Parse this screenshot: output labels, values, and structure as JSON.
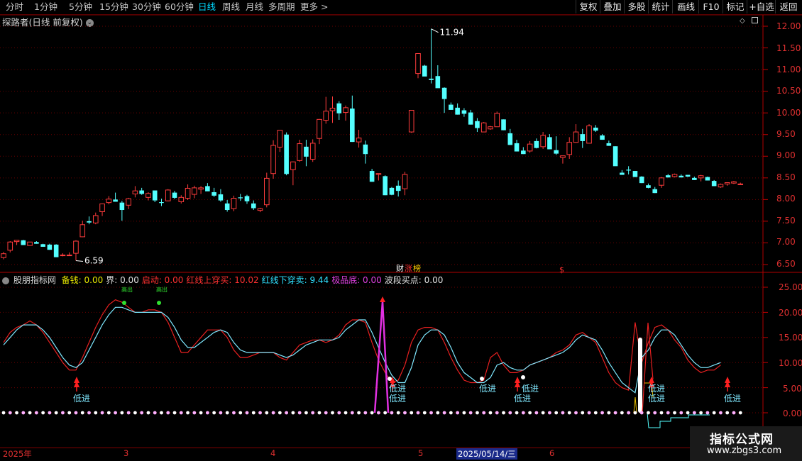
{
  "toolbar": {
    "periods": [
      "分时",
      "1分钟",
      "5分钟",
      "15分钟",
      "30分钟",
      "60分钟",
      "日线",
      "周线",
      "月线",
      "多周期",
      "更多 >"
    ],
    "active_period": "日线",
    "right_buttons": [
      "复权",
      "叠加",
      "多股",
      "统计",
      "画线",
      "F10",
      "标记",
      "+自选",
      "返回"
    ]
  },
  "price_panel": {
    "title": "探路者(日线 前复权)",
    "axis_ticks": [
      "12.00",
      "11.50",
      "11.00",
      "10.50",
      "10.00",
      "9.50",
      "9.00",
      "8.50",
      "8.00",
      "7.50",
      "7.00",
      "6.50"
    ],
    "high_label": "11.94",
    "low_label": "6.59",
    "event_markers": [
      "财",
      "涨",
      "榜",
      "$"
    ]
  },
  "indicator_panel": {
    "name": "股朋指标网",
    "fields": [
      {
        "label": "备钱:",
        "value": "0.00",
        "color": "#e8e800"
      },
      {
        "label": "界:",
        "value": "0.00",
        "color": "#e0e0e0"
      },
      {
        "label": "启动:",
        "value": "0.00",
        "color": "#ff3030"
      },
      {
        "label": "红线上穿买:",
        "value": "10.02",
        "color": "#ff3030"
      },
      {
        "label": "红线下穿卖:",
        "value": "9.44",
        "color": "#30e0ff"
      },
      {
        "label": "极品底:",
        "value": "0.00",
        "color": "#e040e0"
      },
      {
        "label": "波段买点:",
        "value": "0.00",
        "color": "#e0e0e0"
      }
    ],
    "axis_ticks": [
      "25.00",
      "20.00",
      "15.00",
      "10.00",
      "5.00",
      "0.00"
    ],
    "signal_text": "低进",
    "top_marker_text": "高出"
  },
  "datebar": {
    "labels": [
      "2025年",
      "3",
      "4",
      "5",
      "2025/05/14/三",
      "6"
    ]
  },
  "watermark": {
    "line1": "指标公式网",
    "line2": "www.zbgs3.com"
  },
  "chart_data": {
    "type": "candlestick",
    "series": [
      {
        "name": "candles",
        "ohlc": [
          [
            6.66,
            6.79,
            6.62,
            6.75
          ],
          [
            6.83,
            7.04,
            6.78,
            7.02
          ],
          [
            7.03,
            7.06,
            6.95,
            7.06
          ],
          [
            7.06,
            7.07,
            6.95,
            6.95
          ],
          [
            6.94,
            7.02,
            6.94,
            7.02
          ],
          [
            7.02,
            7.04,
            6.98,
            6.98
          ],
          [
            6.97,
            6.98,
            6.91,
            6.91
          ],
          [
            6.96,
            6.98,
            6.84,
            6.84
          ],
          [
            6.96,
            6.97,
            6.67,
            6.67
          ],
          [
            6.71,
            6.76,
            6.69,
            6.72
          ],
          [
            6.71,
            6.78,
            6.7,
            6.72
          ],
          [
            6.76,
            7.06,
            6.59,
            7.04
          ],
          [
            7.14,
            7.51,
            7.13,
            7.42
          ],
          [
            7.5,
            7.61,
            7.43,
            7.47
          ],
          [
            7.46,
            7.7,
            7.43,
            7.63
          ],
          [
            7.72,
            7.91,
            7.62,
            7.9
          ],
          [
            7.93,
            8.08,
            7.89,
            8.01
          ],
          [
            8.0,
            8.16,
            7.98,
            7.95
          ],
          [
            7.93,
            7.97,
            7.51,
            7.76
          ],
          [
            7.87,
            8.04,
            7.78,
            8.02
          ],
          [
            8.13,
            8.31,
            8.05,
            8.2
          ],
          [
            8.21,
            8.27,
            8.11,
            8.13
          ],
          [
            8.05,
            8.17,
            7.98,
            8.14
          ],
          [
            8.21,
            8.21,
            7.94,
            7.98
          ],
          [
            7.94,
            8.02,
            7.85,
            7.92
          ],
          [
            7.97,
            8.24,
            7.96,
            8.22
          ],
          [
            8.16,
            8.2,
            8.01,
            8.04
          ],
          [
            7.95,
            8.1,
            7.91,
            8.05
          ],
          [
            8.03,
            8.35,
            7.99,
            8.26
          ],
          [
            8.12,
            8.32,
            8.03,
            8.27
          ],
          [
            8.24,
            8.31,
            8.13,
            8.27
          ],
          [
            8.31,
            8.38,
            8.22,
            8.19
          ],
          [
            8.17,
            8.27,
            8.06,
            8.09
          ],
          [
            8.12,
            8.24,
            7.95,
            7.98
          ],
          [
            7.91,
            7.99,
            7.72,
            7.76
          ],
          [
            7.79,
            8.09,
            7.73,
            8.03
          ],
          [
            8.05,
            8.13,
            7.97,
            8.03
          ],
          [
            8.08,
            8.11,
            7.9,
            7.96
          ],
          [
            7.91,
            7.98,
            7.76,
            7.8
          ],
          [
            7.75,
            7.81,
            7.71,
            7.79
          ],
          [
            7.88,
            8.62,
            7.82,
            8.49
          ],
          [
            8.6,
            9.37,
            8.48,
            9.25
          ],
          [
            9.21,
            9.53,
            9.1,
            9.6
          ],
          [
            9.5,
            9.55,
            8.56,
            8.59
          ],
          [
            8.69,
            8.88,
            8.33,
            8.87
          ],
          [
            8.9,
            9.38,
            8.87,
            9.29
          ],
          [
            9.22,
            9.38,
            8.77,
            8.99
          ],
          [
            8.93,
            9.39,
            8.87,
            9.3
          ],
          [
            9.41,
            9.86,
            9.28,
            9.85
          ],
          [
            9.83,
            10.37,
            9.75,
            10.04
          ],
          [
            10.05,
            10.38,
            9.77,
            10.11
          ],
          [
            10.22,
            10.27,
            9.84,
            9.99
          ],
          [
            10.01,
            10.17,
            9.82,
            10.12
          ],
          [
            10.1,
            10.4,
            9.33,
            9.33
          ],
          [
            9.33,
            9.61,
            9.2,
            9.42
          ],
          [
            9.27,
            9.36,
            8.83,
            9.05
          ],
          [
            8.66,
            8.71,
            8.41,
            8.41
          ],
          [
            8.58,
            8.6,
            8.44,
            8.6
          ],
          [
            8.54,
            8.56,
            8.1,
            8.1
          ],
          [
            8.27,
            8.29,
            8.1,
            8.11
          ],
          [
            8.32,
            8.44,
            8.07,
            8.2
          ],
          [
            8.25,
            8.64,
            8.1,
            8.58
          ],
          [
            9.56,
            10.03,
            9.54,
            10.06
          ],
          [
            10.91,
            10.94,
            10.8,
            11.37
          ],
          [
            11.09,
            11.11,
            10.89,
            10.84
          ],
          [
            10.79,
            11.94,
            10.68,
            10.76
          ],
          [
            10.85,
            11.1,
            10.71,
            10.57
          ],
          [
            10.58,
            10.59,
            10.0,
            10.32
          ],
          [
            10.19,
            10.24,
            10.07,
            10.07
          ],
          [
            10.12,
            10.22,
            9.96,
            9.96
          ],
          [
            10.06,
            10.11,
            9.91,
            9.98
          ],
          [
            10.01,
            10.07,
            9.73,
            9.73
          ],
          [
            9.81,
            9.88,
            9.56,
            9.65
          ],
          [
            9.56,
            9.79,
            9.59,
            9.77
          ],
          [
            9.63,
            9.7,
            9.61,
            9.68
          ],
          [
            9.68,
            10.03,
            9.68,
            9.99
          ],
          [
            9.85,
            9.85,
            9.6,
            9.6
          ],
          [
            9.53,
            9.63,
            9.26,
            9.26
          ],
          [
            9.3,
            9.38,
            9.11,
            9.11
          ],
          [
            9.13,
            9.21,
            9.05,
            9.05
          ],
          [
            9.12,
            9.35,
            9.08,
            9.28
          ],
          [
            9.35,
            9.41,
            9.18,
            9.19
          ],
          [
            9.22,
            9.56,
            9.17,
            9.48
          ],
          [
            9.44,
            9.51,
            9.23,
            9.16
          ],
          [
            9.14,
            9.46,
            9.03,
            9.06
          ],
          [
            8.97,
            9.01,
            8.83,
            9.01
          ],
          [
            9.04,
            9.44,
            8.94,
            9.32
          ],
          [
            9.32,
            9.74,
            9.31,
            9.56
          ],
          [
            9.51,
            9.63,
            9.19,
            9.35
          ],
          [
            9.3,
            9.74,
            9.3,
            9.7
          ],
          [
            9.66,
            9.72,
            9.56,
            9.59
          ],
          [
            9.48,
            9.51,
            9.38,
            9.38
          ],
          [
            9.3,
            9.36,
            9.24,
            9.24
          ],
          [
            9.23,
            9.23,
            8.78,
            8.77
          ],
          [
            8.62,
            8.68,
            8.57,
            8.57
          ],
          [
            8.69,
            8.77,
            8.58,
            8.67
          ],
          [
            8.66,
            8.66,
            8.52,
            8.52
          ],
          [
            8.53,
            8.54,
            8.38,
            8.38
          ],
          [
            8.33,
            8.37,
            8.26,
            8.27
          ],
          [
            8.24,
            8.29,
            8.15,
            8.15
          ],
          [
            8.33,
            8.52,
            8.27,
            8.5
          ],
          [
            8.56,
            8.59,
            8.51,
            8.51
          ],
          [
            8.53,
            8.6,
            8.51,
            8.58
          ],
          [
            8.55,
            8.58,
            8.52,
            8.51
          ],
          [
            8.57,
            8.57,
            8.52,
            8.53
          ],
          [
            8.5,
            8.53,
            8.45,
            8.45
          ],
          [
            8.5,
            8.57,
            8.42,
            8.55
          ],
          [
            8.52,
            8.53,
            8.44,
            8.44
          ],
          [
            8.43,
            8.45,
            8.31,
            8.31
          ],
          [
            8.29,
            8.37,
            8.27,
            8.35
          ],
          [
            8.36,
            8.4,
            8.32,
            8.39
          ],
          [
            8.38,
            8.43,
            8.36,
            8.41
          ],
          [
            8.36,
            8.39,
            8.34,
            8.36
          ]
        ]
      },
      {
        "name": "红线上穿买",
        "values": [
          14,
          16,
          17,
          17.5,
          18.3,
          17.5,
          16,
          14,
          12,
          10,
          8.5,
          8.5,
          11,
          14,
          17,
          19.5,
          21.5,
          22.5,
          22,
          21,
          20,
          20,
          20.5,
          20.5,
          20,
          18,
          15,
          12,
          12,
          13.5,
          15,
          16.5,
          16.5,
          16.5,
          15,
          12.5,
          11,
          11,
          11.5,
          12,
          12,
          12,
          11,
          10.5,
          12,
          13.5,
          14,
          14.5,
          14.5,
          14,
          14.5,
          15.5,
          17.5,
          18.5,
          18.5,
          18,
          14,
          10.5,
          8,
          6,
          6.5,
          9.5,
          14,
          16.5,
          17,
          17,
          16.5,
          14,
          11,
          8.5,
          6.5,
          6,
          6,
          6.5,
          11,
          12,
          9.5,
          8,
          8,
          8.5,
          9.5,
          10,
          10.5,
          11,
          12,
          12.5,
          13.5,
          15.5,
          16,
          15,
          14,
          11,
          8,
          6,
          5,
          4.5,
          18,
          10,
          14,
          17,
          17.5,
          16.5,
          14.5,
          13,
          10.5,
          9,
          8,
          8.5,
          8.5,
          9.5
        ]
      },
      {
        "name": "红线下穿卖",
        "values": [
          13.5,
          15,
          16.5,
          17.5,
          17.5,
          17.5,
          16.5,
          15,
          13,
          11,
          9.5,
          9,
          10,
          12.5,
          15,
          17.5,
          19.5,
          21,
          21,
          20.5,
          20,
          20,
          20,
          20,
          20,
          19,
          17,
          14.5,
          13,
          13,
          14,
          15,
          16,
          16.5,
          16,
          14,
          12.5,
          12,
          12,
          12,
          12,
          12,
          11.5,
          11,
          11.5,
          12.5,
          13.5,
          14,
          14.5,
          14.5,
          14.5,
          15,
          16.5,
          17.5,
          18.5,
          18.5,
          16,
          13,
          10,
          7.5,
          6,
          6,
          9,
          13.5,
          15.5,
          16.5,
          16.5,
          15.5,
          13,
          10,
          8,
          7,
          6,
          6,
          7,
          9.5,
          10,
          9,
          8.5,
          8.5,
          9.5,
          10,
          10.5,
          11,
          11.5,
          12,
          13,
          14.5,
          15.5,
          15,
          14.5,
          12.5,
          10,
          8,
          6,
          5,
          4,
          11,
          12.5,
          15,
          16.5,
          16.5,
          15.5,
          13.5,
          11.5,
          10,
          9,
          9,
          9.5,
          10
        ]
      }
    ],
    "xlabel": "",
    "ylabel": "",
    "ylim": [
      6.4,
      12.2
    ]
  }
}
